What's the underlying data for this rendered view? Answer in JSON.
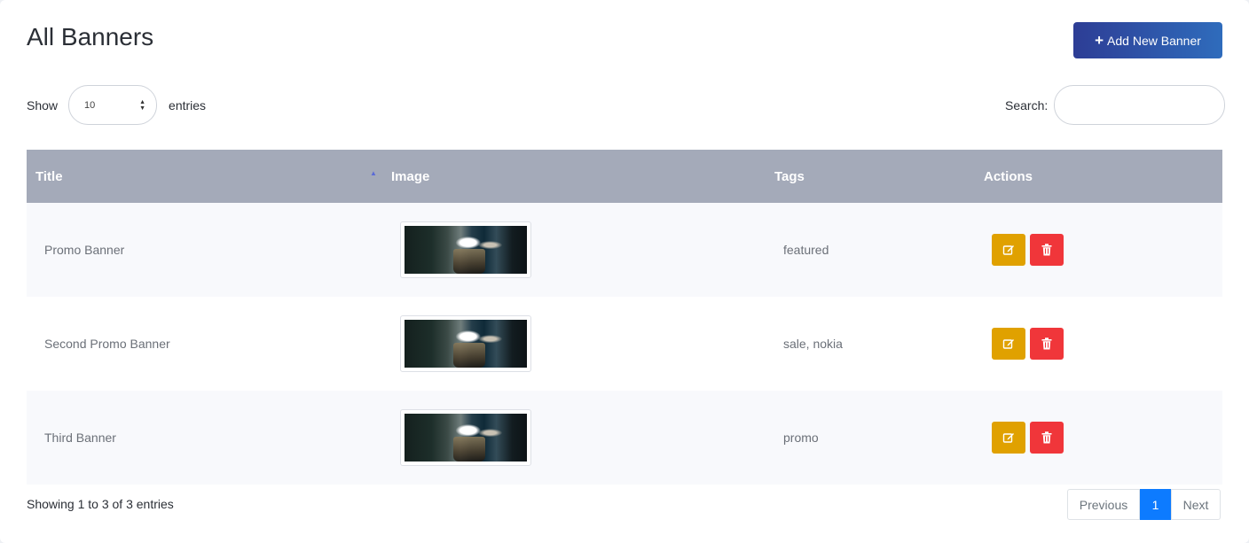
{
  "page": {
    "title": "All Banners",
    "add_button_label": "Add New Banner"
  },
  "controls": {
    "show_label": "Show",
    "entries_value": "10",
    "entries_label": "entries",
    "search_label": "Search:",
    "search_value": ""
  },
  "table": {
    "columns": [
      "Title",
      "Image",
      "Tags",
      "Actions"
    ],
    "sorted_column": "Title",
    "rows": [
      {
        "title": "Promo Banner",
        "tags": "featured"
      },
      {
        "title": "Second Promo Banner",
        "tags": "sale, nokia"
      },
      {
        "title": "Third Banner",
        "tags": "promo"
      }
    ]
  },
  "footer": {
    "info": "Showing 1 to 3 of 3 entries",
    "prev_label": "Previous",
    "current_page": "1",
    "next_label": "Next"
  },
  "colors": {
    "add_button_from": "#2d3d95",
    "add_button_to": "#2f6cbc",
    "header_bg": "#a4aab9",
    "edit_button": "#e0a100",
    "delete_button": "#f0363a",
    "active_page": "#0d7bff"
  },
  "icons": {
    "add": "plus-icon",
    "sort": "sort-asc-icon",
    "edit": "edit-icon",
    "delete": "trash-icon",
    "select": "select-caret-icon"
  }
}
